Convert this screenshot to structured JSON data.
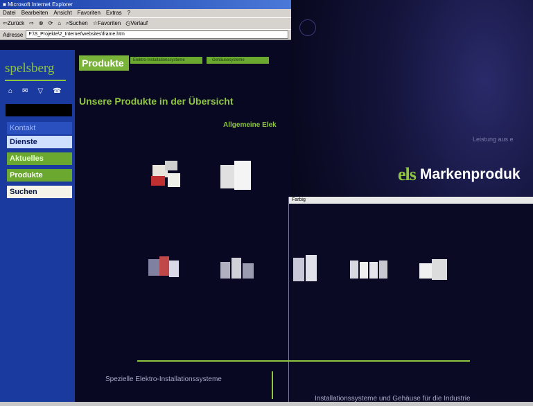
{
  "browser": {
    "title": "Microsoft Internet Explorer",
    "menu": [
      "Datei",
      "Bearbeiten",
      "Ansicht",
      "Favoriten",
      "Extras",
      "?"
    ],
    "toolbar": [
      "Zurück",
      "Suchen",
      "Favoriten",
      "Verlauf"
    ],
    "address_label": "Adresse",
    "address_value": "F:\\S_Projekte\\2_Internet\\websites\\frame.htm"
  },
  "site": {
    "brand": "spelsberg",
    "nav": {
      "kontakt": "Kontakt",
      "dienste": "Dienste",
      "aktuelles": "Aktuelles",
      "produkte": "Produkte",
      "suchen": "Suchen"
    },
    "tabs": [
      "Produkte",
      "Elektro-Installationssysteme",
      "Gehäusesysteme"
    ],
    "heading": "Unsere Produkte in der Übersicht",
    "subheading": "Allgemeine Elek"
  },
  "background": {
    "logo": "els",
    "title": "Markenproduk",
    "tagline": "Leistung aus e"
  },
  "popup": {
    "title": "Farbig"
  },
  "footer": {
    "left": "Spezielle Elektro-Installationssysteme",
    "right": "Installationssysteme und Gehäuse für die Industrie"
  },
  "colors": {
    "accent_green": "#8ec63f",
    "sidebar_blue": "#1a3aa0",
    "page_dark": "#0a0a24"
  }
}
